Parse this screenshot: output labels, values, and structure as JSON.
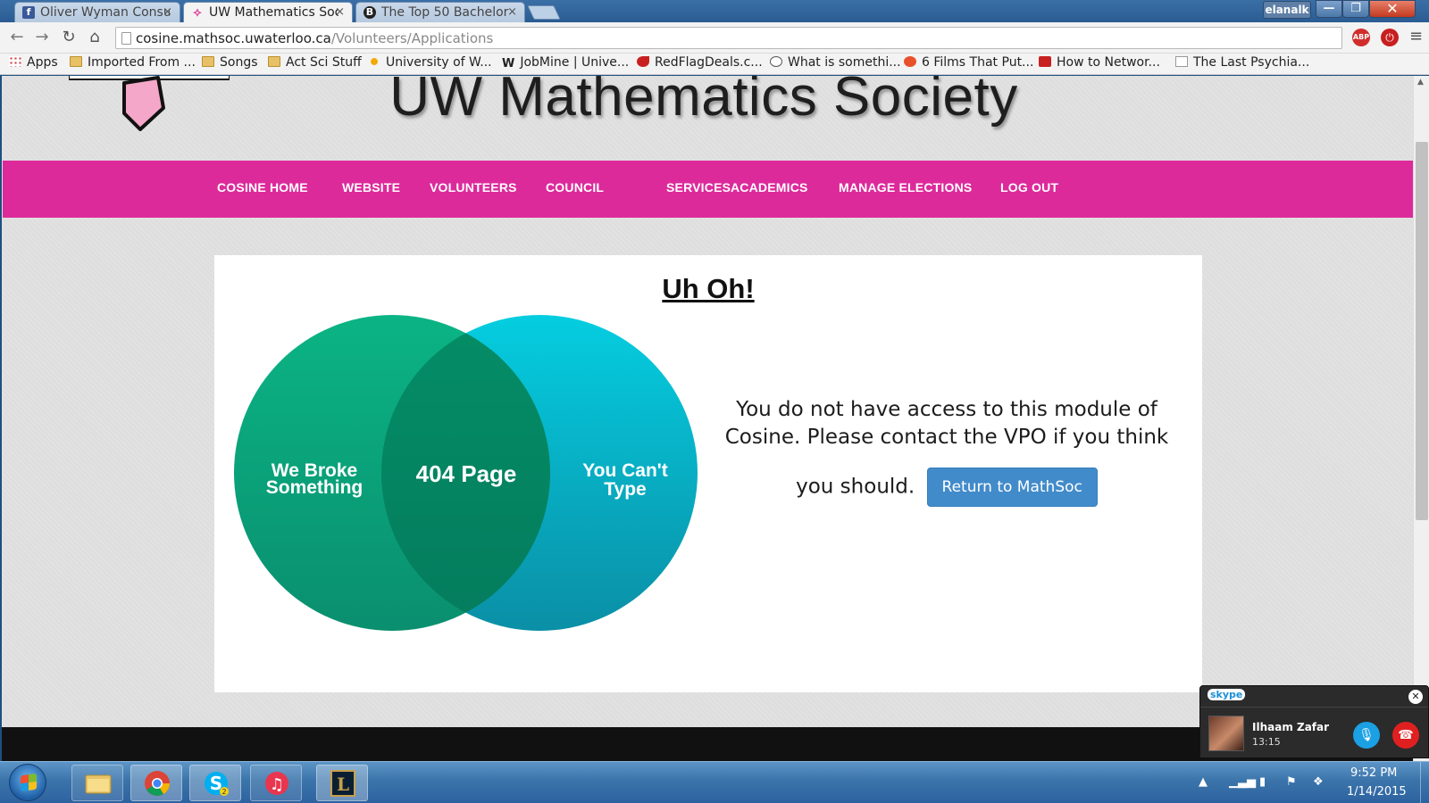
{
  "browser": {
    "tabs": [
      {
        "title": "Oliver Wyman Consu",
        "icon": "facebook-icon",
        "active": false
      },
      {
        "title": "UW Mathematics Soc",
        "icon": "mathsoc-pink-tie-icon",
        "active": true
      },
      {
        "title": "The Top 50 Bachelor",
        "icon": "b-circle-icon",
        "active": false
      }
    ],
    "tab_close_glyph": "×",
    "user_name": "elanalk",
    "url_host": "cosine.mathsoc.uwaterloo.ca",
    "url_path": "/Volunteers/Applications",
    "abp_label": "ABP",
    "bookmarks": [
      {
        "label": "Apps",
        "icon": "apps-grid-icon"
      },
      {
        "label": "Imported From ...",
        "icon": "folder-icon"
      },
      {
        "label": "Songs",
        "icon": "folder-icon"
      },
      {
        "label": "Act Sci Stuff",
        "icon": "folder-icon"
      },
      {
        "label": "University of W...",
        "icon": "uwaterloo-icon"
      },
      {
        "label": "JobMine | Unive...",
        "icon": "w-letter-icon"
      },
      {
        "label": "RedFlagDeals.c...",
        "icon": "redflagdeals-icon"
      },
      {
        "label": "What is somethi...",
        "icon": "reddit-icon"
      },
      {
        "label": "6 Films That Put...",
        "icon": "films-icon"
      },
      {
        "label": "How to Networ...",
        "icon": "how-to-icon"
      },
      {
        "label": "The Last Psychia...",
        "icon": "document-icon"
      }
    ]
  },
  "site": {
    "title": "UW Mathematics Society",
    "nav": [
      "COSINE HOME",
      "WEBSITE",
      "VOLUNTEERS",
      "COUNCIL",
      "SERVICES",
      "ACADEMICS",
      "MANAGE ELECTIONS",
      "LOG OUT"
    ],
    "nav_color": "#dd2a9b"
  },
  "content": {
    "heading": "Uh Oh!",
    "venn": {
      "left_label": "We Broke Something",
      "center_label": "404 Page",
      "right_label": "You Can't Type",
      "left_color": "#0aa77d",
      "right_color": "#05b8cc"
    },
    "message_line1": "You do not have access to this module of Cosine. Please contact the VPO if you think",
    "message_line2": "you should.",
    "return_button": "Return to MathSoc"
  },
  "skype": {
    "brand": "skype",
    "contact_name": "Ilhaam Zafar",
    "call_duration": "13:15"
  },
  "taskbar": {
    "apps": [
      "file-explorer-icon",
      "chrome-icon",
      "skype-icon",
      "itunes-icon",
      "league-of-legends-icon"
    ],
    "skype_badge": "2",
    "clock_time": "9:52 PM",
    "clock_date": "1/14/2015"
  }
}
